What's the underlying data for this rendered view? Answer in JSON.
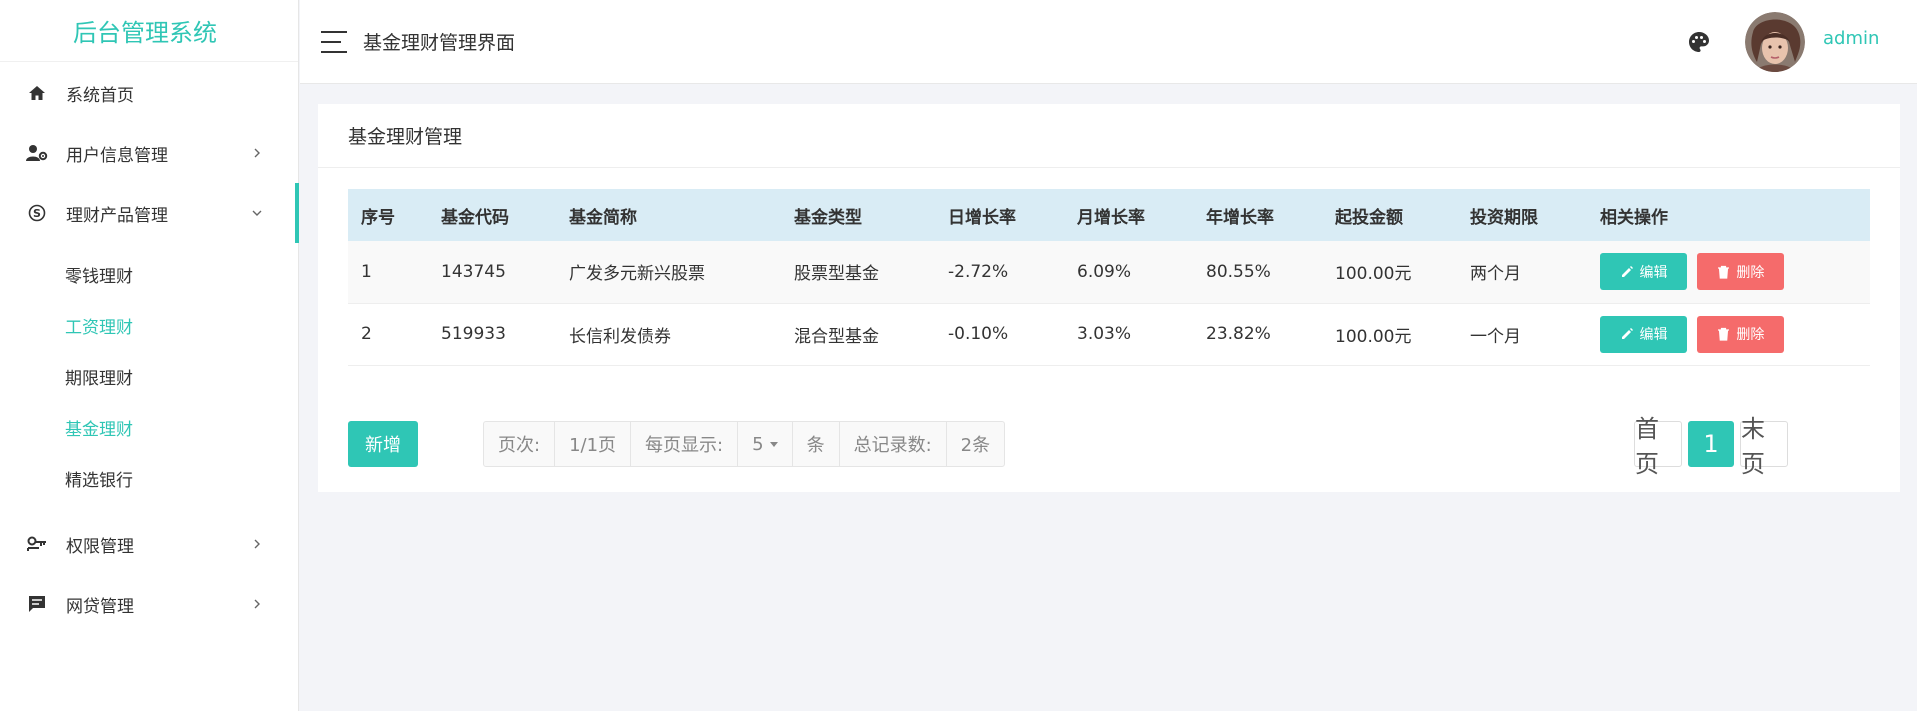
{
  "sidebar": {
    "brand": "后台管理系统",
    "items": [
      {
        "label": "系统首页",
        "icon": "home-icon"
      },
      {
        "label": "用户信息管理",
        "icon": "user-settings-icon"
      },
      {
        "label": "理财产品管理",
        "icon": "skype-icon",
        "expanded": true,
        "children": [
          "零钱理财",
          "工资理财",
          "期限理财",
          "基金理财",
          "精选银行"
        ]
      },
      {
        "label": "权限管理",
        "icon": "key-icon"
      },
      {
        "label": "网贷管理",
        "icon": "message-icon"
      }
    ],
    "selected_child": "基金理财"
  },
  "header": {
    "title": "基金理财管理界面",
    "username": "admin"
  },
  "card": {
    "title": "基金理财管理",
    "columns": [
      "序号",
      "基金代码",
      "基金简称",
      "基金类型",
      "日增长率",
      "月增长率",
      "年增长率",
      "起投金额",
      "投资期限",
      "相关操作"
    ],
    "rows": [
      [
        "1",
        "143745",
        "广发多元新兴股票",
        "股票型基金",
        "-2.72%",
        "6.09%",
        "80.55%",
        "100.00元",
        "两个月"
      ],
      [
        "2",
        "519933",
        "长信利发债券",
        "混合型基金",
        "-0.10%",
        "3.03%",
        "23.82%",
        "100.00元",
        "一个月"
      ]
    ],
    "edit_label": "编辑",
    "delete_label": "删除",
    "add_label": "新增",
    "pageinfo": {
      "page_label": "页次:",
      "page_value": "1/1页",
      "per_page_label": "每页显示:",
      "per_page_value": "5",
      "unit": "条",
      "total_label": "总记录数:",
      "total_value": "2条"
    },
    "pager": {
      "first": "首页",
      "current": "1",
      "last": "末页"
    }
  },
  "colors": {
    "accent": "#2fc6b5",
    "danger": "#f56b6b",
    "table_header": "#d9ecf5"
  }
}
